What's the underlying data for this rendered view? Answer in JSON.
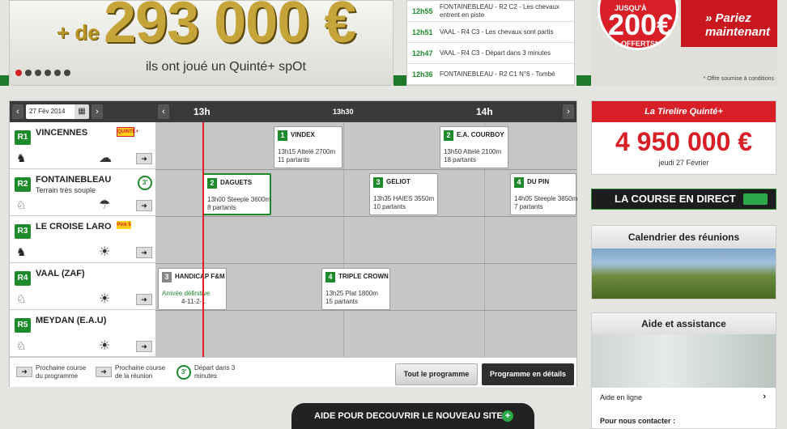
{
  "banner": {
    "prefix": "+ de",
    "amount": "293 000 €",
    "subtitle": "ils ont joué un Quinté+ spOt",
    "slides": 6,
    "active_slide": 1
  },
  "next_races": [
    {
      "time": "12h55",
      "desc": "FONTAINEBLEAU - R2 C2 - Les chevaux entrent en piste"
    },
    {
      "time": "12h51",
      "desc": "VAAL - R4 C3 - Les chevaux sont partis"
    },
    {
      "time": "12h47",
      "desc": "VAAL - R4 C3 - Départ dans 3 minutes"
    },
    {
      "time": "12h36",
      "desc": "FONTAINEBLEAU - R2 C1 N°6 - Tombé"
    }
  ],
  "promo": {
    "jusqu": "JUSQU'À",
    "amount": "200€",
    "offered": "OFFERTS*",
    "cta_line1": "» Pariez",
    "cta_line2": "maintenant",
    "note": "* Offre soumise à conditions"
  },
  "timeline": {
    "date": "27 Fév 2014",
    "times": [
      "13h",
      "13h30",
      "14h"
    ],
    "reunions": [
      {
        "code": "R1",
        "name": "VINCENNES",
        "sub": "",
        "badge": "QUINTÉ+"
      },
      {
        "code": "R2",
        "name": "FONTAINEBLEAU",
        "sub": "Terrain très souple",
        "timer": "3'"
      },
      {
        "code": "R3",
        "name": "LE CROISE LARO",
        "sub": "",
        "badge": "Pick 5"
      },
      {
        "code": "R4",
        "name": "VAAL (ZAF)",
        "sub": ""
      },
      {
        "code": "R5",
        "name": "MEYDAN (E.A.U)",
        "sub": ""
      }
    ],
    "races": [
      {
        "num": "1",
        "name": "VINDEX",
        "line1": "13h15 Attelé 2700m",
        "line2": "11 partants"
      },
      {
        "num": "2",
        "name": "E.A. COURBOY",
        "line1": "13h50 Attelé 2100m",
        "line2": "18 partants"
      },
      {
        "num": "2",
        "name": "DAGUETS",
        "line1": "13h00 Steeple 3600m",
        "line2": "8 partants"
      },
      {
        "num": "3",
        "name": "GELIOT",
        "line1": "13h35 HAIES 3550m",
        "line2": "10 partants"
      },
      {
        "num": "4",
        "name": "DU PIN",
        "line1": "14h05 Steeple 3850m",
        "line2": "7 partants"
      },
      {
        "num": "3",
        "name": "HANDICAP F&M",
        "line1": "Arrivée définitive",
        "line2": "4-11-2-1"
      },
      {
        "num": "4",
        "name": "TRIPLE CROWN",
        "line1": "13h25 Plat 1800m",
        "line2": "15 partants"
      }
    ],
    "legend": {
      "next_prog": "Prochaine course du programme",
      "next_reunion": "Prochaine course de la réunion",
      "depart": "Départ dans 3 minutes",
      "timer": "3'"
    },
    "btn_all": "Tout le programme",
    "btn_detail": "Programme en détails"
  },
  "tirelire": {
    "title": "La Tirelire Quinté+",
    "amount": "4 950 000 €",
    "date": "jeudi 27 Février"
  },
  "direct": {
    "label": "LA COURSE EN DIRECT"
  },
  "calendar": {
    "title": "Calendrier des réunions"
  },
  "aide": {
    "title": "Aide et assistance",
    "link": "Aide en ligne",
    "contact": "Pour nous contacter :"
  },
  "helpbar": {
    "label": "AIDE POUR DECOUVRIR LE NOUVEAU SITE !"
  },
  "colors": {
    "green": "#1f8a2c",
    "red": "#d81e26",
    "dark": "#2e2e2e"
  }
}
